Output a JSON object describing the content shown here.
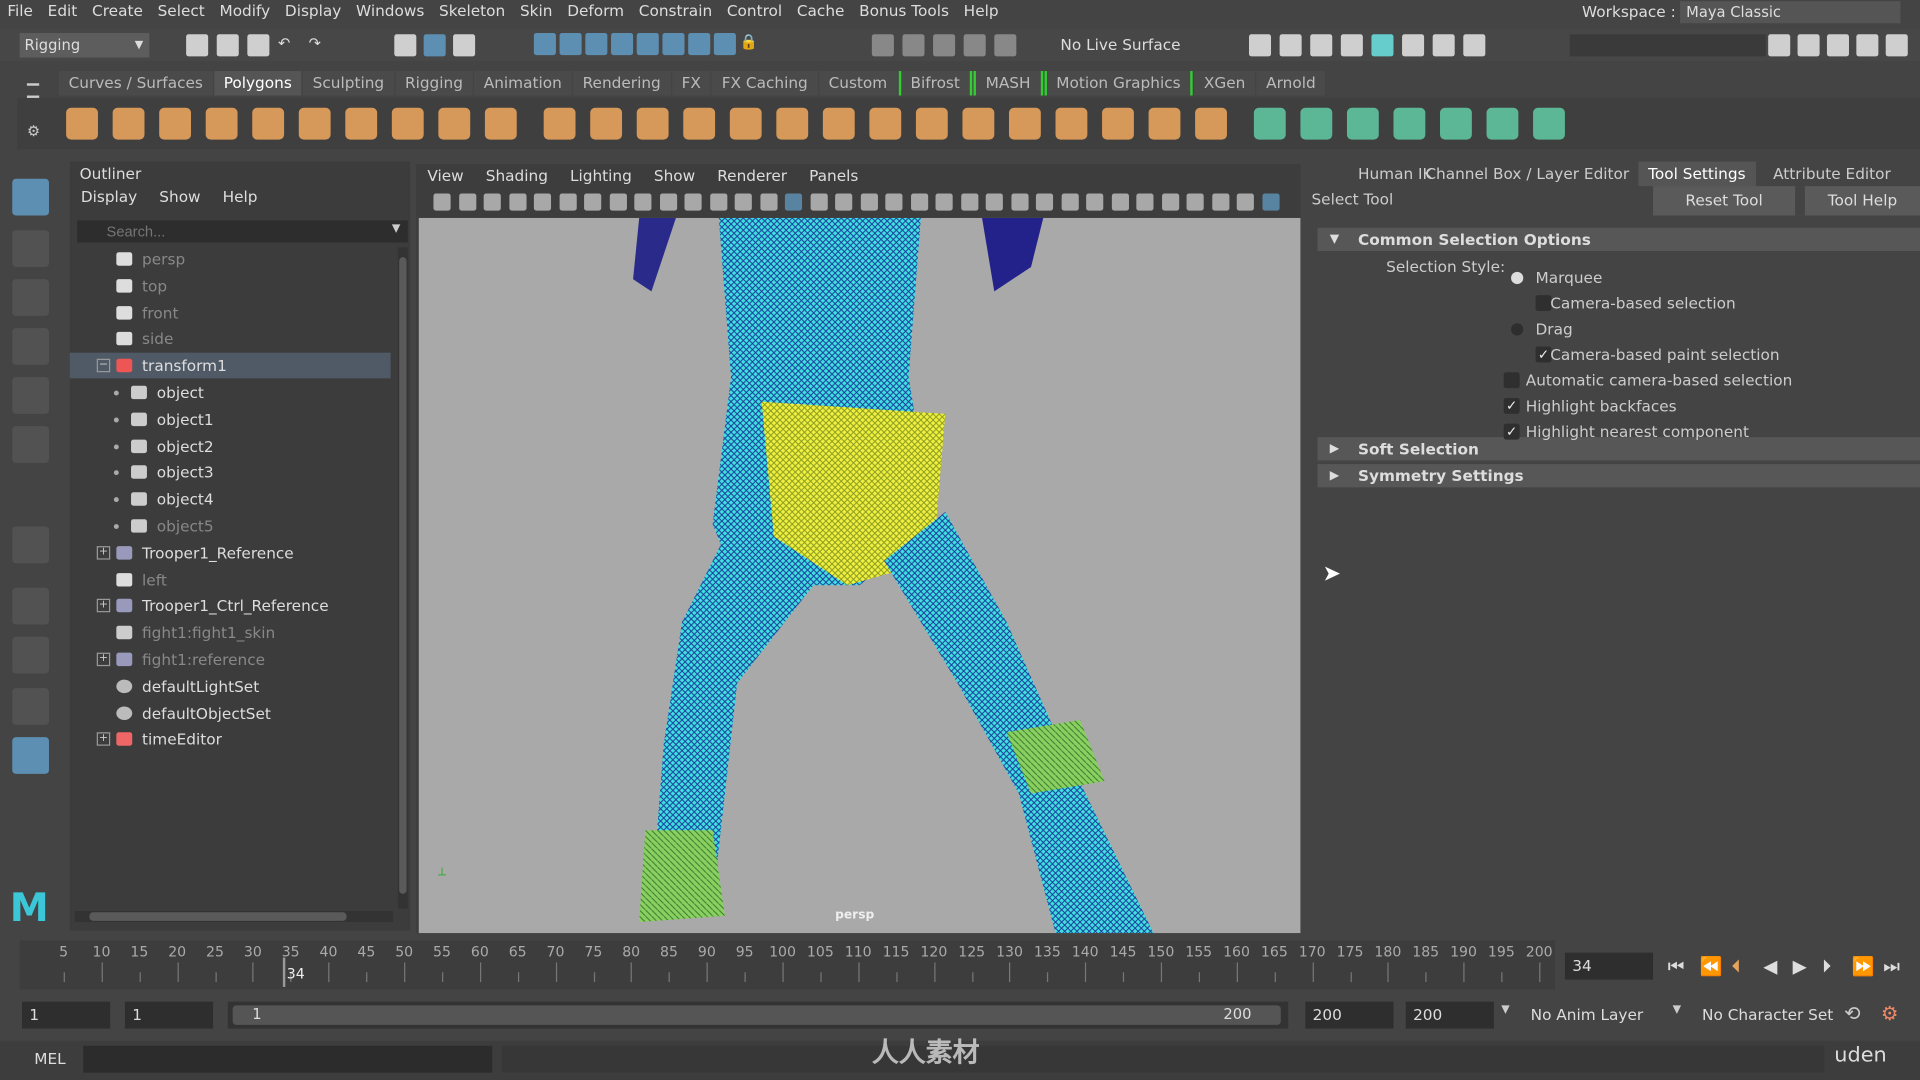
{
  "menubar": [
    "File",
    "Edit",
    "Create",
    "Select",
    "Modify",
    "Display",
    "Windows",
    "Skeleton",
    "Skin",
    "Deform",
    "Constrain",
    "Control",
    "Cache",
    "Bonus Tools",
    "Help"
  ],
  "workspace": {
    "label": "Workspace :",
    "value": "Maya Classic"
  },
  "status": {
    "menu_set": "Rigging",
    "live_surface": "No Live Surface"
  },
  "shelf_tabs": [
    "Curves / Surfaces",
    "Polygons",
    "Sculpting",
    "Rigging",
    "Animation",
    "Rendering",
    "FX",
    "FX Caching",
    "Custom",
    "Bifrost",
    "MASH",
    "Motion Graphics",
    "XGen",
    "Arnold"
  ],
  "shelf_active": "Polygons",
  "outliner": {
    "title": "Outliner",
    "menu": [
      "Display",
      "Show",
      "Help"
    ],
    "search_placeholder": "Search...",
    "items": [
      {
        "label": "persp",
        "indent": 1,
        "icon": "camera-icon",
        "dim": true
      },
      {
        "label": "top",
        "indent": 1,
        "icon": "camera-icon",
        "dim": true
      },
      {
        "label": "front",
        "indent": 1,
        "icon": "camera-icon",
        "dim": true
      },
      {
        "label": "side",
        "indent": 1,
        "icon": "camera-icon",
        "dim": true
      },
      {
        "label": "transform1",
        "indent": 1,
        "icon": "transform-icon",
        "expand": "-",
        "selected": true
      },
      {
        "label": "object",
        "indent": 2,
        "icon": "mesh-icon"
      },
      {
        "label": "object1",
        "indent": 2,
        "icon": "mesh-icon"
      },
      {
        "label": "object2",
        "indent": 2,
        "icon": "mesh-icon"
      },
      {
        "label": "object3",
        "indent": 2,
        "icon": "mesh-icon"
      },
      {
        "label": "object4",
        "indent": 2,
        "icon": "mesh-icon"
      },
      {
        "label": "object5",
        "indent": 2,
        "icon": "mesh-icon",
        "dim": true
      },
      {
        "label": "Trooper1_Reference",
        "indent": 1,
        "icon": "joint-icon",
        "expand": "+"
      },
      {
        "label": "left",
        "indent": 1,
        "icon": "camera-icon",
        "dim": true
      },
      {
        "label": "Trooper1_Ctrl_Reference",
        "indent": 1,
        "icon": "joint-icon",
        "expand": "+"
      },
      {
        "label": "fight1:fight1_skin",
        "indent": 1,
        "icon": "mesh-icon",
        "dim": true
      },
      {
        "label": "fight1:reference",
        "indent": 1,
        "icon": "joint-icon",
        "expand": "+",
        "dim": true
      },
      {
        "label": "defaultLightSet",
        "indent": 1,
        "icon": "set-icon"
      },
      {
        "label": "defaultObjectSet",
        "indent": 1,
        "icon": "set-icon"
      },
      {
        "label": "timeEditor",
        "indent": 1,
        "icon": "time-editor-icon",
        "expand": "+"
      }
    ]
  },
  "viewport": {
    "menu": [
      "View",
      "Shading",
      "Lighting",
      "Show",
      "Renderer",
      "Panels"
    ],
    "camera_label": "persp"
  },
  "right_panel": {
    "tabs": [
      "Human IK",
      "Channel Box / Layer Editor",
      "Tool Settings",
      "Attribute Editor"
    ],
    "active_tab": "Tool Settings",
    "tool_name": "Select Tool",
    "reset": "Reset Tool",
    "help": "Tool Help",
    "sections": {
      "common": "Common Selection Options",
      "soft": "Soft Selection",
      "symmetry": "Symmetry Settings"
    },
    "selection_style_label": "Selection Style:",
    "options": {
      "marquee": "Marquee",
      "camera_based": "Camera-based selection",
      "drag": "Drag",
      "camera_paint": "Camera-based paint selection",
      "auto_camera": "Automatic camera-based selection",
      "backfaces": "Highlight backfaces",
      "nearest": "Highlight nearest component"
    },
    "checked": {
      "marquee": true,
      "camera_based": false,
      "drag": false,
      "camera_paint": true,
      "auto_camera": false,
      "backfaces": true,
      "nearest": true
    }
  },
  "timeline": {
    "start": 5,
    "end": 200,
    "step": 5,
    "current": 34,
    "current_label": "34",
    "current_field": "34"
  },
  "range": {
    "start": "1",
    "playback_start": "1",
    "slider_start": "1",
    "slider_end": "200",
    "playback_end": "200",
    "end": "200",
    "anim_layer": "No Anim Layer",
    "character_set": "No Character Set"
  },
  "cmdline": {
    "label": "MEL"
  },
  "watermark": "人人素材",
  "brand": "uden",
  "colors": {
    "accent": "#5d8fb3",
    "shelf_orange": "#e8a35c",
    "shelf_green": "#5fc4a0",
    "wire_cyan": "#40e0e0",
    "wire_yellow": "#f0f040"
  }
}
